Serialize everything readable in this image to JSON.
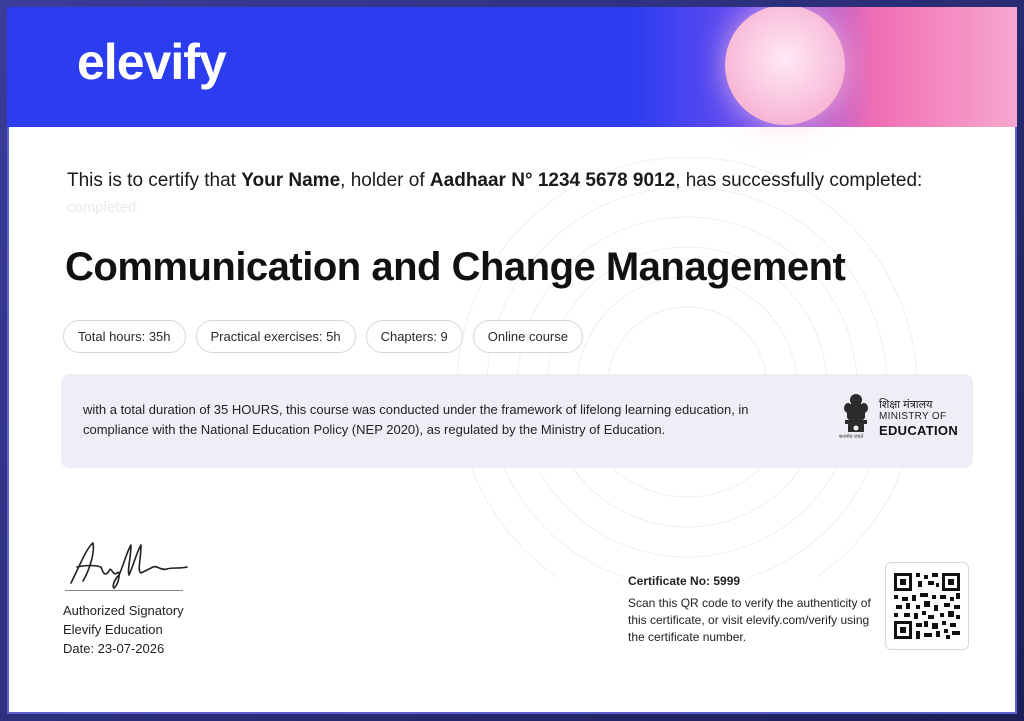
{
  "brand": {
    "logo_text": "elevify",
    "header_color": "#2c3df0",
    "accent_pink": "#f06eb3"
  },
  "certificate": {
    "intro_prefix": "This is to certify that ",
    "recipient_name": "Your Name",
    "intro_middle": ", holder of ",
    "aadhaar": "Aadhaar N° 1234 5678 9012",
    "intro_suffix": ", has successfully completed:",
    "ghost_text": "completed:",
    "course_title": "Communication and Change Management",
    "chips": [
      "Total hours: 35h",
      "Practical exercises: 5h",
      "Chapters: 9",
      "Online course"
    ],
    "description": "with a total duration of 35 HOURS, this course was conducted under the framework of lifelong learning education, in compliance with the National Education Policy (NEP 2020), as regulated by the Ministry of Education."
  },
  "ministry": {
    "hindi": "शिक्षा मंत्रालय",
    "line1": "MINISTRY OF",
    "line2": "EDUCATION",
    "emblem_caption": "सत्यमेव जयते",
    "emblem_icon": "ashoka-emblem-icon"
  },
  "signatory": {
    "role": "Authorized Signatory",
    "organization": "Elevify Education",
    "date": "Date: 23-07-2026"
  },
  "verification": {
    "certificate_no": "Certificate No: 5999",
    "instructions": "Scan this QR code to verify the authenticity of this certificate, or visit elevify.com/verify using the certificate number.",
    "qr_icon": "qr-code-icon"
  }
}
